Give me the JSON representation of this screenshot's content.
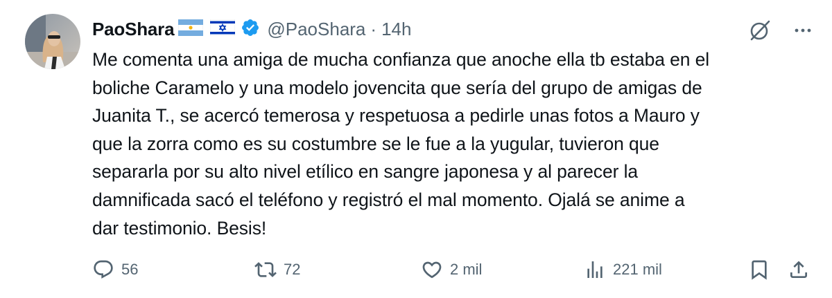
{
  "author": {
    "display_name": "PaoShara",
    "handle": "@PaoShara",
    "separator": "·",
    "time": "14h",
    "flags": [
      "argentina-flag",
      "israel-flag"
    ],
    "verified": true
  },
  "tweet": {
    "text": "Me comenta una amiga de mucha confianza que anoche ella tb estaba en el\nboliche Caramelo y una modelo jovencita que sería del grupo de amigas de\nJuanita T., se acercó temerosa y respetuosa a pedirle unas fotos a Mauro y\nque la zorra como es su costumbre se le fue a la yugular, tuvieron que\nsepararla por su alto nivel etílico en sangre japonesa y al parecer la\ndamnificada sacó el teléfono y registró el mal momento. Ojalá se anime a\ndar testimonio. Besis!"
  },
  "actions": {
    "replies": "56",
    "reposts": "72",
    "likes": "2 mil",
    "views": "221 mil"
  },
  "colors": {
    "text": "#0f1419",
    "muted": "#536471",
    "verified": "#1d9bf0",
    "ar_flag_blue": "#74acdf",
    "il_flag_blue": "#0038b8"
  },
  "icons": {
    "top": [
      "grok-icon",
      "more-icon"
    ],
    "actions": [
      "reply-icon",
      "retweet-icon",
      "like-icon",
      "views-icon",
      "bookmark-icon",
      "share-icon"
    ]
  }
}
